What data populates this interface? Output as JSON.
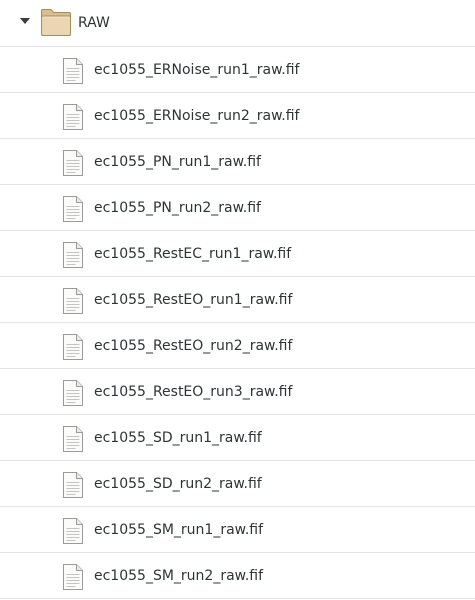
{
  "folder": {
    "name": "RAW",
    "icon": "folder-icon",
    "expanded": true
  },
  "files": [
    {
      "name": "ec1055_ERNoise_run1_raw.fif",
      "icon": "text-file-icon"
    },
    {
      "name": "ec1055_ERNoise_run2_raw.fif",
      "icon": "text-file-icon"
    },
    {
      "name": "ec1055_PN_run1_raw.fif",
      "icon": "text-file-icon"
    },
    {
      "name": "ec1055_PN_run2_raw.fif",
      "icon": "text-file-icon"
    },
    {
      "name": "ec1055_RestEC_run1_raw.fif",
      "icon": "text-file-icon"
    },
    {
      "name": "ec1055_RestEO_run1_raw.fif",
      "icon": "text-file-icon"
    },
    {
      "name": "ec1055_RestEO_run2_raw.fif",
      "icon": "text-file-icon"
    },
    {
      "name": "ec1055_RestEO_run3_raw.fif",
      "icon": "text-file-icon"
    },
    {
      "name": "ec1055_SD_run1_raw.fif",
      "icon": "text-file-icon"
    },
    {
      "name": "ec1055_SD_run2_raw.fif",
      "icon": "text-file-icon"
    },
    {
      "name": "ec1055_SM_run1_raw.fif",
      "icon": "text-file-icon"
    },
    {
      "name": "ec1055_SM_run2_raw.fif",
      "icon": "text-file-icon"
    }
  ],
  "colors": {
    "row_divider": "#e3e3e1",
    "text": "#2e3436",
    "folder_tan": "#e8d3ad",
    "file_paper": "#fbfbfa"
  }
}
